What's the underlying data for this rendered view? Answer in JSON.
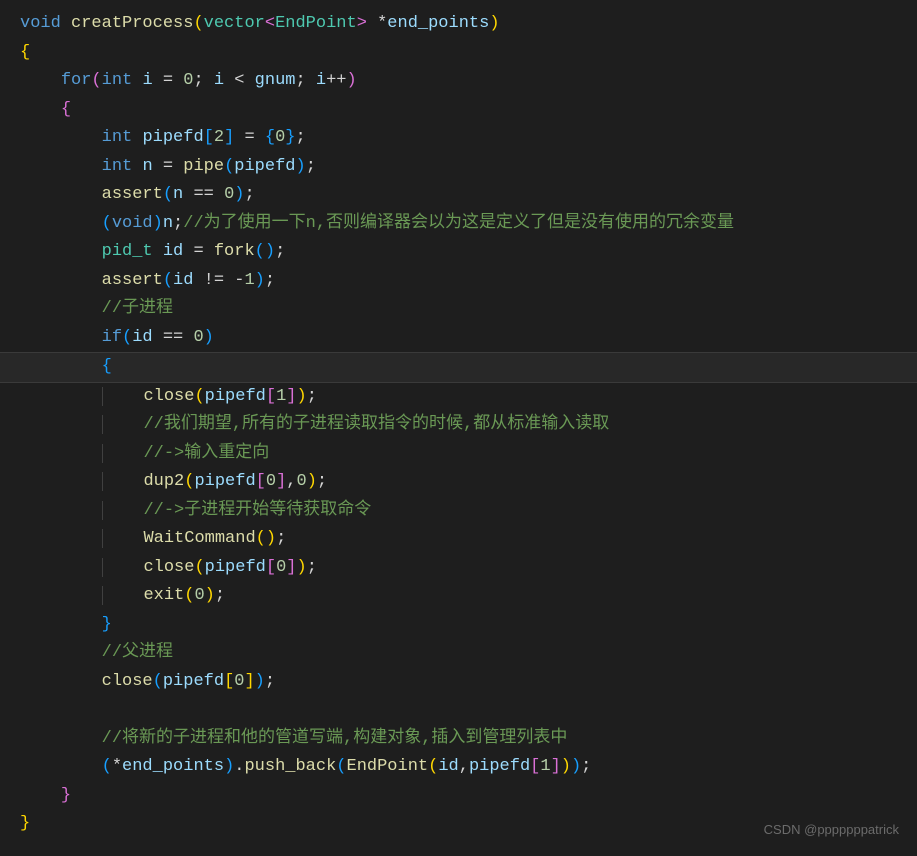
{
  "code": {
    "l1_void": "void",
    "l1_func": "creatProcess",
    "l1_vector": "vector",
    "l1_endpoint": "EndPoint",
    "l1_param": "end_points",
    "l3_for": "for",
    "l3_int": "int",
    "l3_i": "i",
    "l3_eq": " = ",
    "l3_zero": "0",
    "l3_semi": "; ",
    "l3_i2": "i",
    "l3_lt": " < ",
    "l3_gnum": "gnum",
    "l3_semi2": "; ",
    "l3_i3": "i",
    "l3_inc": "++",
    "l5_int": "int",
    "l5_pipefd": "pipefd",
    "l5_two": "2",
    "l5_zero": "0",
    "l6_int": "int",
    "l6_n": "n",
    "l6_pipe": "pipe",
    "l6_pipefd": "pipefd",
    "l7_assert": "assert",
    "l7_n": "n",
    "l7_zero": "0",
    "l8_void": "void",
    "l8_n": "n",
    "l8_comment": "//为了使用一下n,否则编译器会以为这是定义了但是没有使用的冗余变量",
    "l9_pidt": "pid_t",
    "l9_id": "id",
    "l9_fork": "fork",
    "l10_assert": "assert",
    "l10_id": "id",
    "l10_neg1": "1",
    "l11_comment": "//子进程",
    "l12_if": "if",
    "l12_id": "id",
    "l12_zero": "0",
    "l14_close": "close",
    "l14_pipefd": "pipefd",
    "l14_one": "1",
    "l15_comment": "//我们期望,所有的子进程读取指令的时候,都从标准输入读取",
    "l16_comment": "//->输入重定向",
    "l17_dup2": "dup2",
    "l17_pipefd": "pipefd",
    "l17_zero1": "0",
    "l17_zero2": "0",
    "l18_comment": "//->子进程开始等待获取命令",
    "l19_wait": "WaitCommand",
    "l20_close": "close",
    "l20_pipefd": "pipefd",
    "l20_zero": "0",
    "l21_exit": "exit",
    "l21_zero": "0",
    "l23_comment": "//父进程",
    "l24_close": "close",
    "l24_pipefd": "pipefd",
    "l24_zero": "0",
    "l26_comment": "//将新的子进程和他的管道写端,构建对象,插入到管理列表中",
    "l27_endpoints": "end_points",
    "l27_pushback": "push_back",
    "l27_endpoint": "EndPoint",
    "l27_id": "id",
    "l27_pipefd": "pipefd",
    "l27_one": "1"
  },
  "watermark": "CSDN @pppppppatrick"
}
